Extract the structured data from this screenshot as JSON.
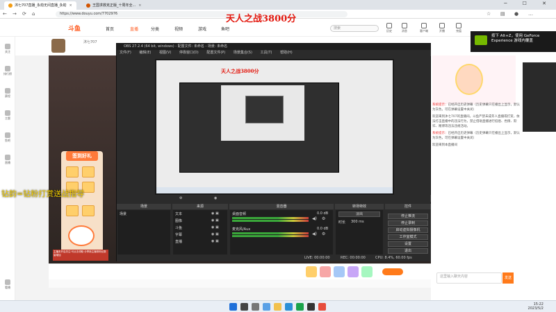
{
  "browser": {
    "tabs": [
      {
        "label": "沐七707直播_永劫无间直播_永劫",
        "active": true
      },
      {
        "label": "王国求救克正版_十周年全..."
      }
    ],
    "url": "https://www.douyu.com/7702976"
  },
  "overlay": {
    "title": "天人之战3800分",
    "yellow_text": "钻韵=钻粉打赏送战指导"
  },
  "douyu": {
    "logo": "斗鱼",
    "nav": [
      "首页",
      "直播",
      "分类",
      "视频",
      "游戏",
      "鱼吧"
    ],
    "active_nav": "直播",
    "search_placeholder": "搜索",
    "icons": [
      "历史",
      "消息",
      "客户端",
      "开播",
      "充值"
    ]
  },
  "sidebar": [
    "关注",
    "排行榜",
    "赛程",
    "主题",
    "鱼吧",
    "直播",
    "看播"
  ],
  "streamer": {
    "name": "沐七707"
  },
  "promo": {
    "title": "签到好礼",
    "note": "主播未开启关注·可点击领取·分享新主播带粉丝数量增加"
  },
  "obs": {
    "title": "OBS 27.2.4 (64 bit, windows) - 配置文件: 未命名 - 场景: 未命名",
    "menu": [
      "文件(F)",
      "编辑(E)",
      "视图(V)",
      "停靠窗口(D)",
      "配置文件(P)",
      "场景集合(S)",
      "工具(T)",
      "帮助(H)"
    ],
    "docks": {
      "scenes": {
        "title": "场景",
        "items": [
          "场景"
        ]
      },
      "sources": {
        "title": "来源",
        "items": [
          "文本",
          "图像",
          "斗鱼",
          "字幕",
          "直播"
        ]
      },
      "mixer": {
        "title": "混音器",
        "channels": [
          "桌面音频",
          "麦克风/Aux"
        ],
        "level": "0.0 dB"
      },
      "transitions": {
        "title": "转场特效",
        "type": "淡出",
        "duration_label": "时长",
        "duration": "300 ms"
      },
      "controls": {
        "title": "控件",
        "buttons": [
          "停止推流",
          "停止录制",
          "启动虚拟摄像机",
          "工作室模式",
          "设置",
          "退出"
        ]
      }
    },
    "status": {
      "live": "LIVE: 00:00:00",
      "rec": "REC: 00:00:00",
      "cpu": "CPU: 8.4%, 60.00 fps"
    }
  },
  "ad": {
    "line1": "按下 Alt+Z，使用 GeForce",
    "line2": "Experience 游戏内覆盖"
  },
  "chat": {
    "messages": [
      {
        "sys": "系统提示：",
        "text": "已经开启历史弹幕（历史弹幕只在播出上显示，默认为灰色，可在弹幕设置中关闭）"
      },
      {
        "sys": "",
        "text": "欢迎来到沐七707的直播间。斗鱼严禁未成年人直播或打赏，依法打击直播中的违法行为，禁止借助直播进行低俗、色情、欺诈、赌博等违法违规活动。"
      },
      {
        "sys": "系统提示：",
        "text": "已经开启历史弹幕（历史弹幕只在播出上显示，默认为灰色，可在弹幕设置中关闭）"
      },
      {
        "sys": "",
        "text": "欢迎来到本直播间"
      }
    ],
    "input_placeholder": "这里输入聊天内容",
    "send": "发送"
  },
  "taskbar": {
    "time": "15:22",
    "date": "2023/5/2"
  }
}
